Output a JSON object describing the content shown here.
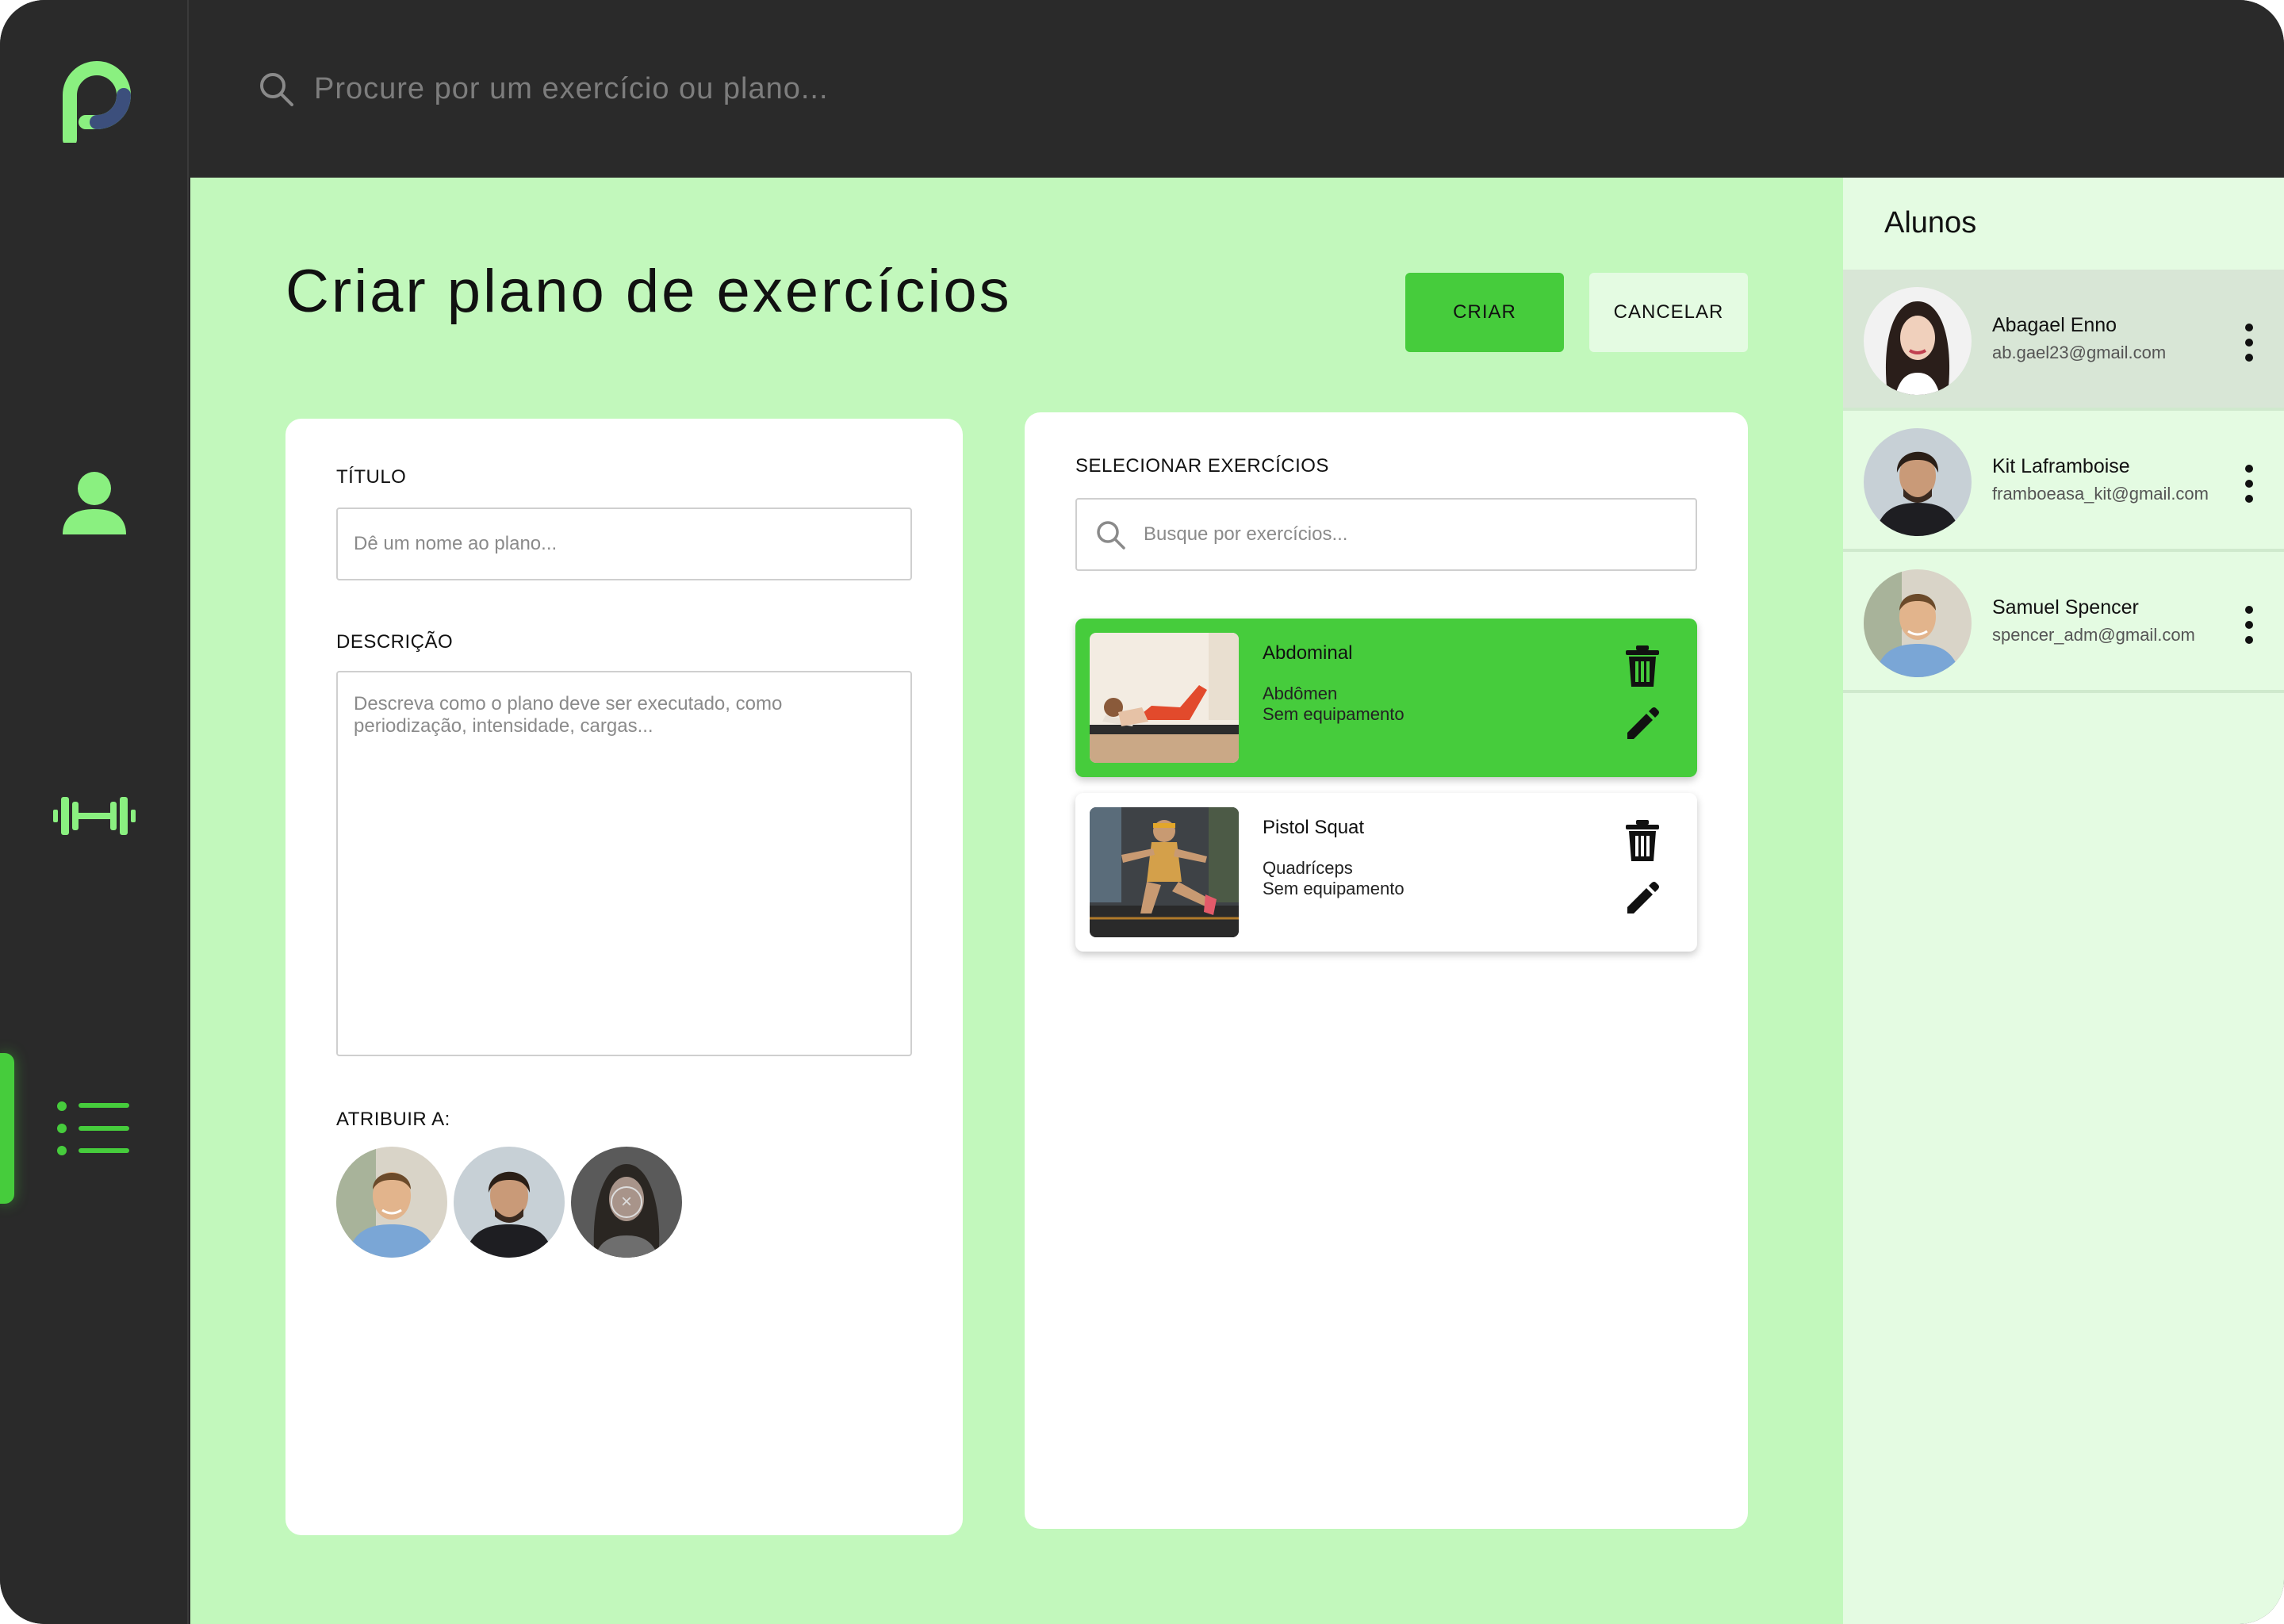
{
  "colors": {
    "accent": "#46cc3c",
    "sidebar_bg": "#2a2a2a",
    "main_bg": "#c2f8bc",
    "panel_bg": "#e4fbe2",
    "icon_green": "#8af080"
  },
  "topbar": {
    "search_placeholder": "Procure por um exercício ou plano..."
  },
  "sidebar": {
    "items": [
      {
        "icon": "user-icon"
      },
      {
        "icon": "dumbbell-icon"
      },
      {
        "icon": "list-icon",
        "active": true
      }
    ]
  },
  "page": {
    "title": "Criar plano de exercícios",
    "create_label": "CRIAR",
    "cancel_label": "CANCELAR"
  },
  "form": {
    "title_label": "TÍTULO",
    "title_placeholder": "Dê um nome ao plano...",
    "description_label": "DESCRIÇÃO",
    "description_placeholder": "Descreva como o plano deve ser executado, como periodização, intensidade, cargas...",
    "assign_label": "ATRIBUIR A:"
  },
  "exercises": {
    "section_label": "SELECIONAR EXERCÍCIOS",
    "search_placeholder": "Busque por exercícios...",
    "items": [
      {
        "name": "Abdominal",
        "muscle": "Abdômen",
        "equipment": "Sem equipamento",
        "selected": true
      },
      {
        "name": "Pistol Squat",
        "muscle": "Quadríceps",
        "equipment": "Sem equipamento",
        "selected": false
      }
    ]
  },
  "students": {
    "title": "Alunos",
    "items": [
      {
        "name": "Abagael Enno",
        "email": "ab.gael23@gmail.com"
      },
      {
        "name": "Kit Laframboise",
        "email": "framboeasa_kit@gmail.com"
      },
      {
        "name": "Samuel Spencer",
        "email": "spencer_adm@gmail.com"
      }
    ]
  }
}
